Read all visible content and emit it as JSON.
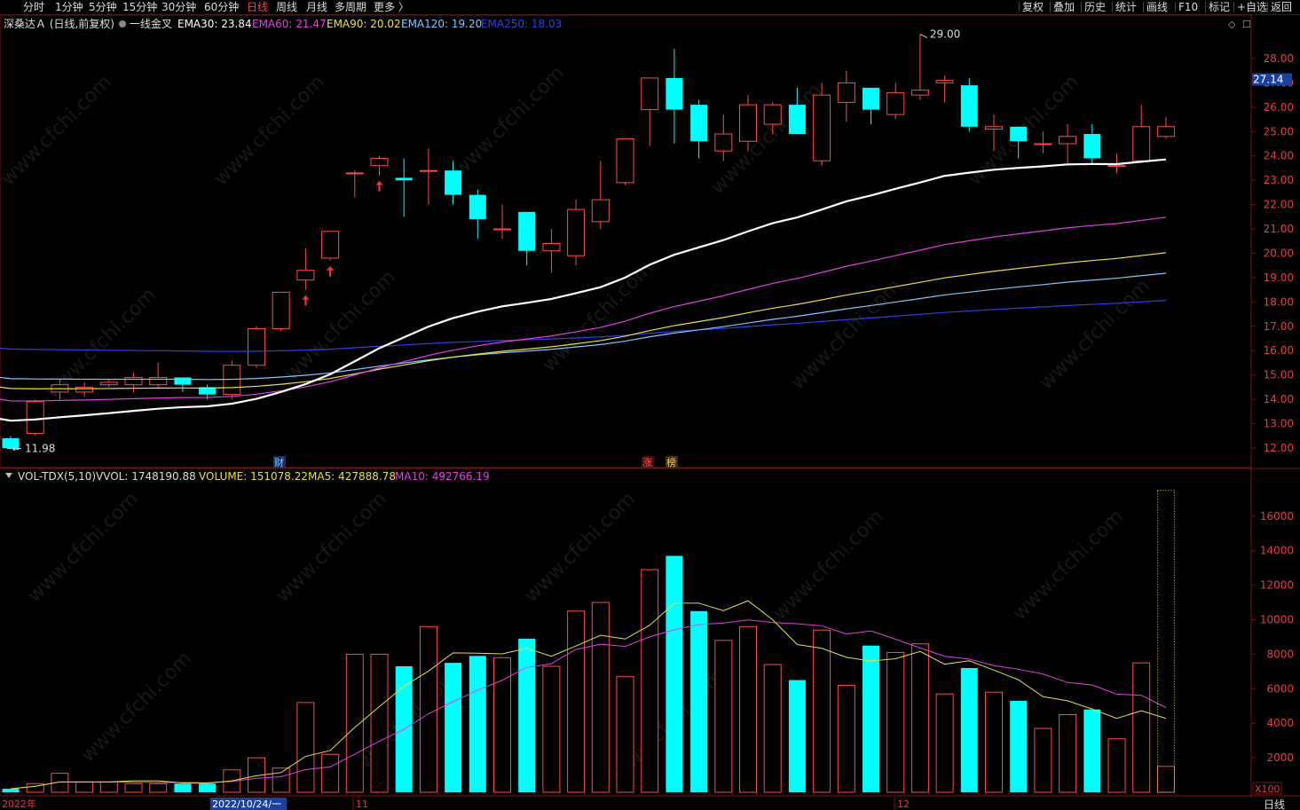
{
  "toolbar": {
    "left_tabs": [
      "分时",
      "1分钟",
      "5分钟",
      "15分钟",
      "30分钟",
      "60分钟",
      "日线",
      "周线",
      "月线",
      "多周期",
      "更多 〉"
    ],
    "active_tab": "日线",
    "right_buttons": [
      "复权",
      "叠加",
      "历史",
      "统计",
      "画线",
      "F10",
      "标记",
      "+自选",
      "返回"
    ]
  },
  "main_legend": {
    "stock": "深桑达Ａ (日线,前复权)",
    "indicator": "一线金叉",
    "items": [
      {
        "label": "EMA30: 23.84",
        "color": "#ffffff"
      },
      {
        "label": "EMA60: 21.47",
        "color": "#e040e0"
      },
      {
        "label": "EMA90: 20.02",
        "color": "#e8e040"
      },
      {
        "label": "EMA120: 19.20",
        "color": "#7ec8ff"
      },
      {
        "label": "EMA250: 18.03",
        "color": "#3040e0"
      }
    ]
  },
  "vol_legend": {
    "name": "VOL-TDX(5,10)",
    "items": [
      {
        "label": "VVOL: 1748190.88",
        "color": "#dddddd"
      },
      {
        "label": "VOLUME: 151078.22",
        "color": "#e8e040"
      },
      {
        "label": "MA5: 427888.78",
        "color": "#e8e040"
      },
      {
        "label": "MA10: 492766.19",
        "color": "#e040e0"
      }
    ]
  },
  "price_axis": {
    "min": 11.5,
    "max": 29.5,
    "ticks": [
      "12.00",
      "13.00",
      "14.00",
      "15.00",
      "16.00",
      "17.00",
      "18.00",
      "19.00",
      "20.00",
      "21.00",
      "22.00",
      "23.00",
      "24.00",
      "25.00",
      "26.00",
      "27.00",
      "28.00"
    ],
    "current": "27.14"
  },
  "vol_axis": {
    "min": 0,
    "max": 17500,
    "ticks": [
      "2000",
      "4000",
      "6000",
      "8000",
      "10000",
      "12000",
      "14000",
      "16000"
    ],
    "unit": "X100"
  },
  "annotations": {
    "low": "11.98",
    "high": "29.00",
    "finance_tag": "财",
    "zhang_tag": "涨",
    "bang_tag": "榜"
  },
  "date_axis": {
    "labels": [
      "2022年",
      "2022/10/24/一",
      "11",
      "12"
    ],
    "period": "日线"
  },
  "watermark": "www.cfchi.com",
  "colors": {
    "up": "#ff4a4a",
    "down": "#00ffff",
    "ema30": "#ffffff",
    "ema60": "#e040e0",
    "ema90": "#e8e040",
    "ema120": "#7ec8ff",
    "ema250": "#3040e0"
  },
  "chart_data": {
    "type": "candlestick",
    "candles": [
      [
        12.4,
        12.0,
        12.5,
        11.98
      ],
      [
        12.6,
        13.9,
        14.0,
        12.5
      ],
      [
        14.3,
        14.6,
        14.8,
        14.0
      ],
      [
        14.3,
        14.5,
        14.7,
        14.1
      ],
      [
        14.6,
        14.7,
        14.8,
        14.5
      ],
      [
        14.6,
        14.9,
        15.1,
        14.3
      ],
      [
        14.6,
        14.9,
        15.5,
        14.5
      ],
      [
        14.9,
        14.6,
        14.9,
        14.3
      ],
      [
        14.5,
        14.2,
        14.6,
        14.0
      ],
      [
        14.2,
        15.4,
        15.6,
        14.0
      ],
      [
        15.4,
        16.9,
        17.0,
        15.3
      ],
      [
        16.9,
        18.4,
        18.4,
        16.8
      ],
      [
        18.9,
        19.3,
        20.2,
        18.5
      ],
      [
        19.8,
        20.9,
        20.9,
        19.7
      ],
      [
        23.3,
        23.3,
        23.4,
        22.3
      ],
      [
        23.6,
        23.9,
        24.0,
        23.2
      ],
      [
        23.1,
        23.0,
        23.9,
        21.5
      ],
      [
        23.4,
        23.4,
        24.3,
        22.0
      ],
      [
        23.4,
        22.4,
        23.8,
        22.0
      ],
      [
        22.4,
        21.4,
        22.6,
        20.6
      ],
      [
        21.0,
        21.0,
        22.0,
        20.6
      ],
      [
        21.7,
        20.1,
        21.7,
        19.5
      ],
      [
        20.1,
        20.4,
        21.0,
        19.2
      ],
      [
        19.9,
        21.8,
        22.2,
        19.5
      ],
      [
        21.3,
        22.2,
        23.8,
        21.0
      ],
      [
        22.9,
        24.7,
        24.7,
        22.8
      ],
      [
        25.9,
        27.2,
        27.2,
        24.4
      ],
      [
        27.2,
        25.9,
        28.4,
        24.5
      ],
      [
        26.1,
        24.6,
        26.3,
        23.9
      ],
      [
        24.2,
        24.9,
        25.7,
        23.8
      ],
      [
        24.6,
        26.1,
        26.5,
        24.2
      ],
      [
        25.3,
        26.1,
        26.2,
        24.9
      ],
      [
        26.1,
        24.9,
        26.8,
        24.9
      ],
      [
        23.8,
        26.5,
        27.0,
        23.6
      ],
      [
        26.2,
        27.0,
        27.5,
        25.4
      ],
      [
        26.8,
        25.9,
        26.8,
        25.3
      ],
      [
        25.7,
        26.6,
        27.0,
        25.5
      ],
      [
        26.5,
        26.7,
        29.0,
        26.3
      ],
      [
        27.0,
        27.1,
        27.3,
        26.2
      ],
      [
        26.9,
        25.2,
        27.2,
        25.0
      ],
      [
        25.1,
        25.2,
        25.7,
        24.2
      ],
      [
        25.2,
        24.6,
        25.2,
        23.9
      ],
      [
        24.5,
        24.5,
        25.0,
        24.1
      ],
      [
        24.5,
        24.8,
        25.3,
        23.7
      ],
      [
        24.9,
        23.9,
        25.3,
        23.7
      ],
      [
        23.6,
        23.6,
        24.1,
        23.3
      ],
      [
        23.8,
        25.2,
        26.1,
        23.7
      ],
      [
        24.8,
        25.2,
        25.6,
        24.7
      ]
    ],
    "volume": [
      2,
      5,
      11,
      6,
      6,
      5,
      5,
      5,
      5,
      13,
      20,
      14,
      52,
      22,
      80,
      80,
      73,
      96,
      75,
      79,
      78,
      89,
      73,
      105,
      110,
      67,
      129,
      137,
      105,
      88,
      96,
      74,
      65,
      94,
      62,
      85,
      81,
      86,
      57,
      72,
      58,
      53,
      37,
      45,
      48,
      31,
      75,
      15
    ],
    "volume_unit": "x100 (thousands)",
    "last_volume_max": 175
  }
}
